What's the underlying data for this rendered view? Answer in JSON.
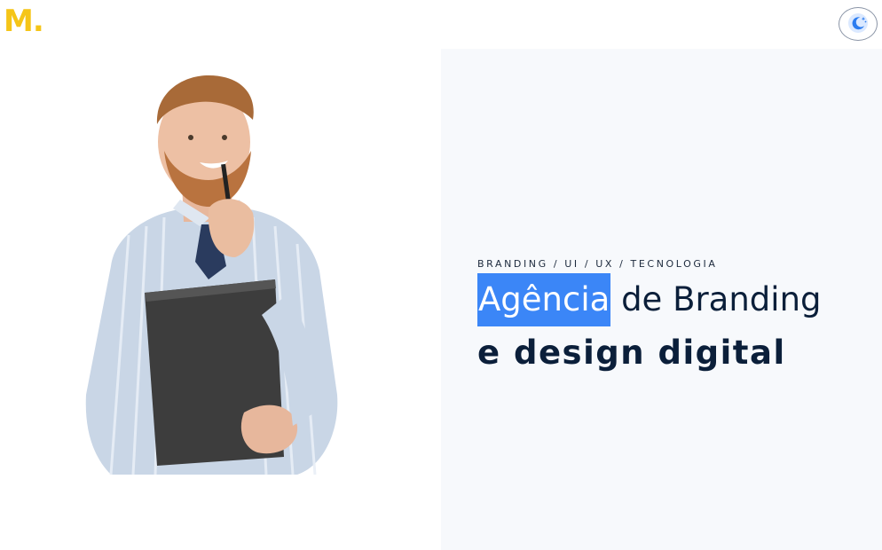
{
  "header": {
    "logo_letter": "M",
    "logo_dot": ".",
    "theme_toggle_icon": "moon-stars-icon"
  },
  "hero": {
    "eyebrow": "BRANDING / UI / UX / TECNOLOGIA",
    "headline_highlight": "Agência",
    "headline_rest": " de Branding",
    "headline_bold": "e design digital",
    "image_icon": "man-holding-folder-photo"
  },
  "colors": {
    "brand_yellow": "#f5c518",
    "highlight_blue": "#3b86f7",
    "navy_text": "#0b1f3a",
    "panel_bg": "#f7f9fc"
  }
}
